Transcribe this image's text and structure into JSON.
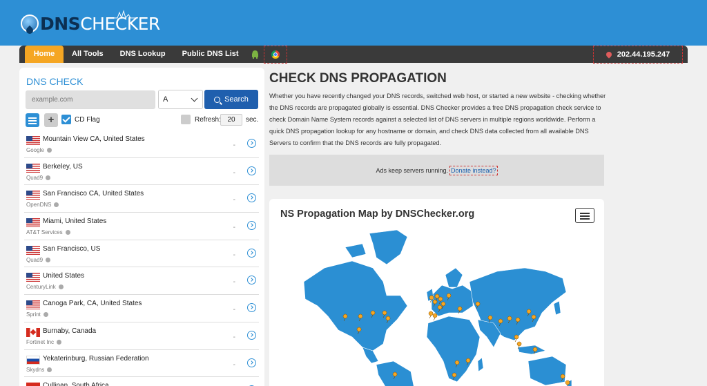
{
  "brand": {
    "dns": "DNS",
    "checker": "CHECKER"
  },
  "nav": {
    "items": [
      "Home",
      "All Tools",
      "DNS Lookup",
      "Public DNS List"
    ],
    "ip": "202.44.195.247"
  },
  "check": {
    "title": "DNS CHECK",
    "placeholder": "example.com",
    "record_type": "A",
    "search_label": "Search",
    "cd_flag_label": "CD Flag",
    "refresh_label": "Refresh:",
    "refresh_value": "20",
    "refresh_unit": "sec."
  },
  "servers": [
    {
      "location": "Mountain View CA, United States",
      "provider": "Google",
      "flag": "us",
      "result": "-"
    },
    {
      "location": "Berkeley, US",
      "provider": "Quad9",
      "flag": "us",
      "result": "-"
    },
    {
      "location": "San Francisco CA, United States",
      "provider": "OpenDNS",
      "flag": "us",
      "result": "-"
    },
    {
      "location": "Miami, United States",
      "provider": "AT&T Services",
      "flag": "us",
      "result": "-"
    },
    {
      "location": "San Francisco, US",
      "provider": "Quad9",
      "flag": "us",
      "result": "-"
    },
    {
      "location": "United States",
      "provider": "CenturyLink",
      "flag": "us",
      "result": "-"
    },
    {
      "location": "Canoga Park, CA, United States",
      "provider": "Sprint",
      "flag": "us",
      "result": "-"
    },
    {
      "location": "Burnaby, Canada",
      "provider": "Fortinet Inc",
      "flag": "ca",
      "result": "-"
    },
    {
      "location": "Yekaterinburg, Russian Federation",
      "provider": "Skydns",
      "flag": "ru",
      "result": "-"
    },
    {
      "location": "Cullinan, South Africa",
      "provider": "",
      "flag": "za",
      "result": "-"
    }
  ],
  "main": {
    "title": "CHECK DNS PROPAGATION",
    "description": "Whether you have recently changed your DNS records, switched web host, or started a new website - checking whether the DNS records are propagated globally is essential. DNS Checker provides a free DNS propagation check service to check Domain Name System records against a selected list of DNS servers in multiple regions worldwide. Perform a quick DNS propagation lookup for any hostname or domain, and check DNS data collected from all available DNS Servers to confirm that the DNS records are fully propagated.",
    "ad_text": "Ads keep servers running.",
    "donate_text": "Donate instead?",
    "map_title": "NS Propagation Map by DNSChecker.org"
  },
  "colors": {
    "brand_blue": "#2d8fd5",
    "nav_dark": "#3a3a3a",
    "home_orange": "#f5a623",
    "search_blue": "#1f5fae",
    "map_land": "#2b8fd3",
    "pin": "#f5a623"
  }
}
